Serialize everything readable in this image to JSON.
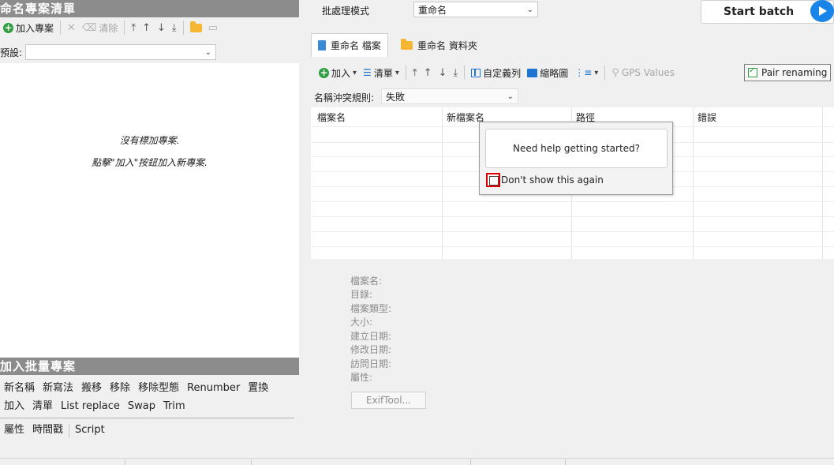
{
  "left": {
    "title": "命名專案清單",
    "toolbar": {
      "add": "加入專案",
      "clear": "清除"
    },
    "preset_label": "預設:",
    "preset_value": "",
    "empty_line1": "沒有標加專案.",
    "empty_line2": "點擊\"加入\"按鈕加入新專案.",
    "batch_title": "加入批量專案",
    "batch_row1": [
      "新名稱",
      "新寫法",
      "搬移",
      "移除",
      "移除型態",
      "Renumber",
      "置換"
    ],
    "batch_row2": [
      "加入",
      "清單",
      "List replace",
      "Swap",
      "Trim"
    ],
    "batch_row3": [
      "屬性",
      "時間戳",
      "Script"
    ]
  },
  "right": {
    "batch_mode_label": "批處理模式",
    "batch_mode_value": "重命名",
    "start_batch": "Start batch",
    "tabs": [
      "重命名 檔案",
      "重命名 資料夾"
    ],
    "toolbar": {
      "add": "加入",
      "list": "清單",
      "custom_sort": "自定義列",
      "thumbnails": "縮略圖",
      "gps": "GPS Values",
      "pair_renaming": "Pair renaming"
    },
    "conflict_label": "名稱沖突規則:",
    "conflict_value": "失敗",
    "columns": [
      "檔案名",
      "新檔案名",
      "路徑",
      "錯誤"
    ],
    "props": [
      "檔案名:",
      "目錄:",
      "檔案類型:",
      "大小:",
      "建立日期:",
      "修改日期:",
      "訪問日期:",
      "屬性:"
    ],
    "exiftool": "ExifTool...",
    "popup": {
      "help": "Need help getting started?",
      "dont_show": "Don't show this again"
    }
  },
  "colors": {
    "accent": "#1a85e8",
    "green": "#2e9e3e",
    "header_gray": "#8c8c8c",
    "highlight_red": "#e00000"
  }
}
